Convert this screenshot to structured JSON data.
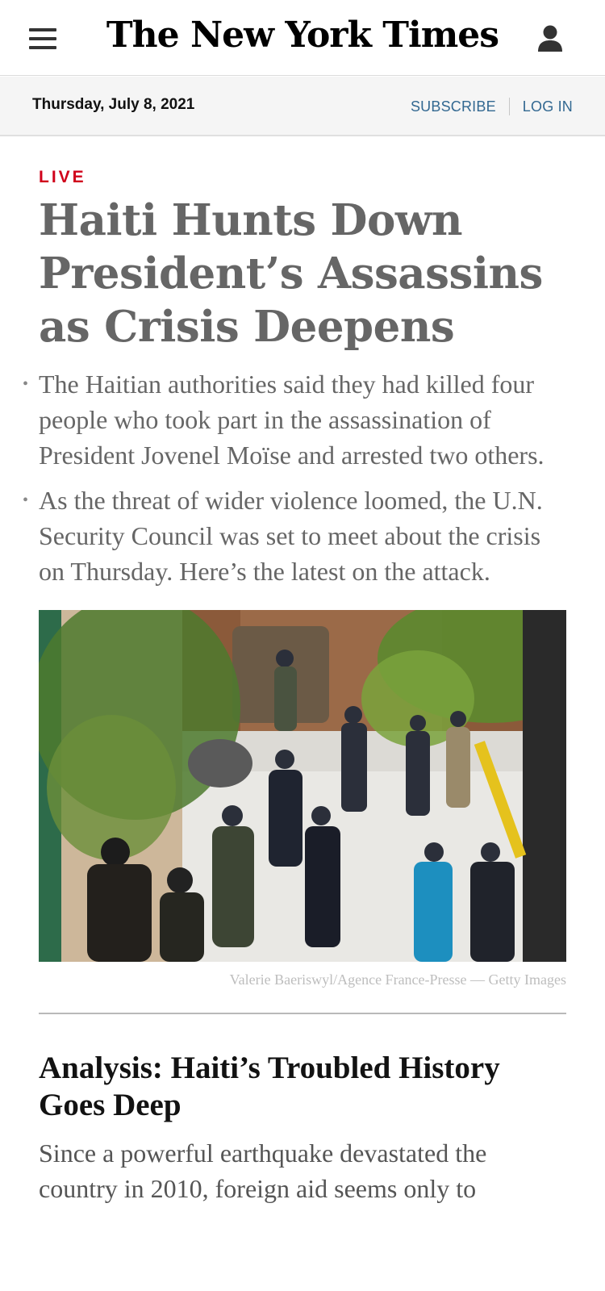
{
  "header": {
    "logo": "The New York Times",
    "menu_icon": "hamburger-menu-icon",
    "account_icon": "user-account-icon"
  },
  "datebar": {
    "date": "Thursday, July 8, 2021",
    "subscribe_label": "SUBSCRIBE",
    "login_label": "LOG IN"
  },
  "article": {
    "label": "LIVE",
    "headline": "Haiti Hunts Down President’s Assassins as Crisis Deepens",
    "bullets": [
      "The Haitian authorities said they had killed four people who took part in the assassination of President Jovenel Moïse and arrested two others.",
      "As the threat of wider violence loomed, the U.N. Security Council was set to meet about the crisis on Thursday. Here’s the latest on the attack."
    ],
    "photo_credit": "Valerie Baeriswyl/Agence France-Presse — Getty Images"
  },
  "analysis": {
    "title": "Analysis: Haiti’s Troubled History Goes Deep",
    "summary": "Since a powerful earthquake devastated the country in 2010, foreign aid seems only to"
  },
  "colors": {
    "live_red": "#d0021b",
    "link_blue": "#326891",
    "headline_gray": "#666666"
  }
}
